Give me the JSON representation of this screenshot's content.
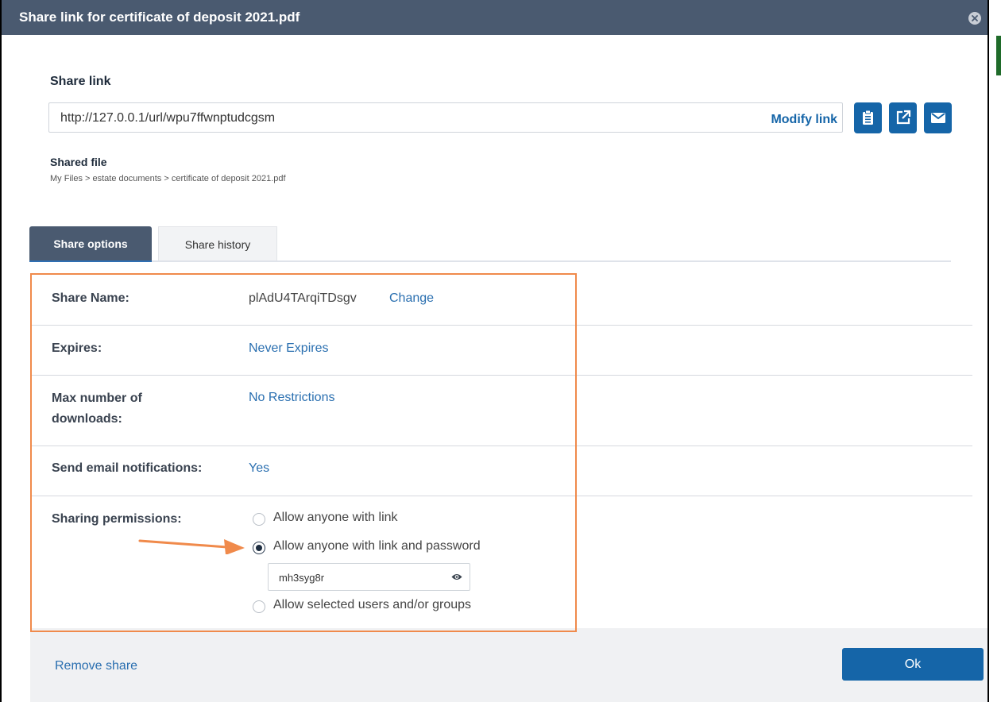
{
  "dialog": {
    "title": "Share link for certificate of deposit 2021.pdf"
  },
  "share_link": {
    "label": "Share link",
    "url": "http://127.0.0.1/url/wpu7ffwnptudcgsm",
    "modify_label": "Modify link"
  },
  "shared_file": {
    "label": "Shared file",
    "path": "My Files > estate documents > certificate of deposit 2021.pdf"
  },
  "tabs": [
    {
      "label": "Share options",
      "active": true
    },
    {
      "label": "Share history",
      "active": false
    }
  ],
  "options": {
    "share_name": {
      "label": "Share Name:",
      "value": "plAdU4TArqiTDsgv",
      "action": "Change"
    },
    "expires": {
      "label": "Expires:",
      "value": "Never Expires"
    },
    "max_downloads": {
      "label_line1": "Max number of",
      "label_line2": "downloads:",
      "value": "No Restrictions"
    },
    "email_notifications": {
      "label": "Send email notifications:",
      "value": "Yes"
    },
    "sharing_permissions": {
      "label": "Sharing permissions:",
      "choices": [
        {
          "label": "Allow anyone with link",
          "checked": false
        },
        {
          "label": "Allow anyone with link and password",
          "checked": true
        },
        {
          "label": "Allow selected users and/or groups",
          "checked": false
        }
      ],
      "password": "mh3syg8r"
    }
  },
  "footer": {
    "remove_label": "Remove share",
    "ok_label": "Ok"
  },
  "icons": {
    "close": "close-icon",
    "clipboard": "clipboard-icon",
    "external": "external-link-icon",
    "email": "envelope-icon",
    "eye": "eye-icon"
  },
  "colors": {
    "title_bar": "#4a5a70",
    "primary": "#1565a8",
    "link": "#2a6fb0",
    "annotation": "#f08a4b"
  }
}
